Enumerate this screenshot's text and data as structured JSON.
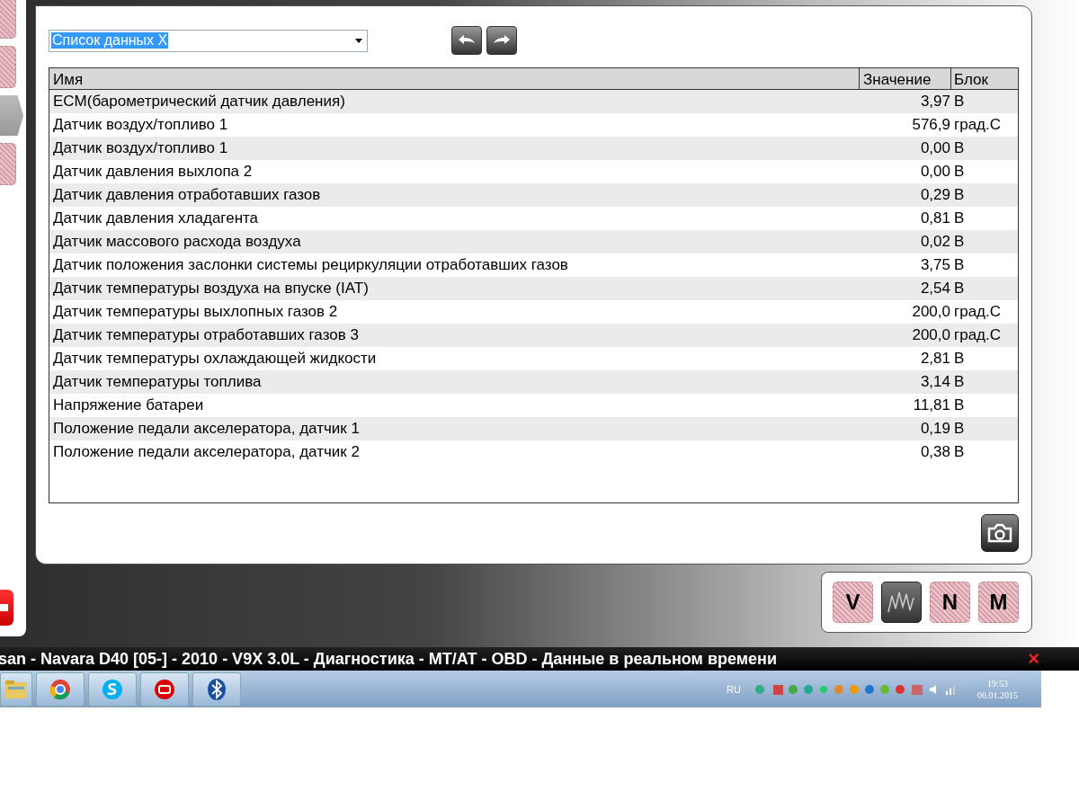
{
  "sidebar": {
    "items": [
      {
        "selected": false
      },
      {
        "selected": false
      },
      {
        "selected": true
      },
      {
        "selected": false
      }
    ]
  },
  "data_list": {
    "value": "Список данных X"
  },
  "table": {
    "columns": [
      "Имя",
      "Значение",
      "Блок"
    ],
    "rows": [
      [
        "ECM(барометрический датчик давления)",
        "3,97",
        "В"
      ],
      [
        "Датчик воздух/топливо 1",
        "576,9",
        "град.С"
      ],
      [
        "Датчик воздух/топливо 1",
        "0,00",
        "В"
      ],
      [
        "Датчик давления выхлопа 2",
        "0,00",
        "В"
      ],
      [
        "Датчик давления отработавших газов",
        "0,29",
        "В"
      ],
      [
        "Датчик давления хладагента",
        "0,81",
        "В"
      ],
      [
        "Датчик массового расхода воздуха",
        "0,02",
        "В"
      ],
      [
        "Датчик положения заслонки системы рециркуляции отработавших газов",
        "3,75",
        "В"
      ],
      [
        "Датчик температуры воздуха на впуске (IAT)",
        "2,54",
        "В"
      ],
      [
        "Датчик температуры выхлопных газов 2",
        "200,0",
        "град.С"
      ],
      [
        "Датчик температуры отработавших газов 3",
        "200,0",
        "град.С"
      ],
      [
        "Датчик температуры охлаждающей жидкости",
        "2,81",
        "В"
      ],
      [
        "Датчик температуры топлива",
        "3,14",
        "В"
      ],
      [
        "Напряжение батареи",
        "11,81",
        "В"
      ],
      [
        "Положение педали акселератора, датчик 1",
        "0,19",
        "В"
      ],
      [
        "Положение педали акселератора, датчик 2",
        "0,38",
        "В"
      ]
    ]
  },
  "mode_buttons": [
    {
      "kind": "letter",
      "label": "V",
      "selected": false
    },
    {
      "kind": "graph",
      "selected": true
    },
    {
      "kind": "letter",
      "label": "N",
      "selected": false
    },
    {
      "kind": "letter",
      "label": "M",
      "selected": false
    }
  ],
  "title_bar": {
    "title": "san - Navara D40 [05-] - 2010 - V9X 3.0L - Диагностика - MT/AT - OBD - Данные в реальном времени",
    "close": "×"
  },
  "taskbar": {
    "language": "RU",
    "time": "19:53",
    "date": "06.01.2015"
  }
}
